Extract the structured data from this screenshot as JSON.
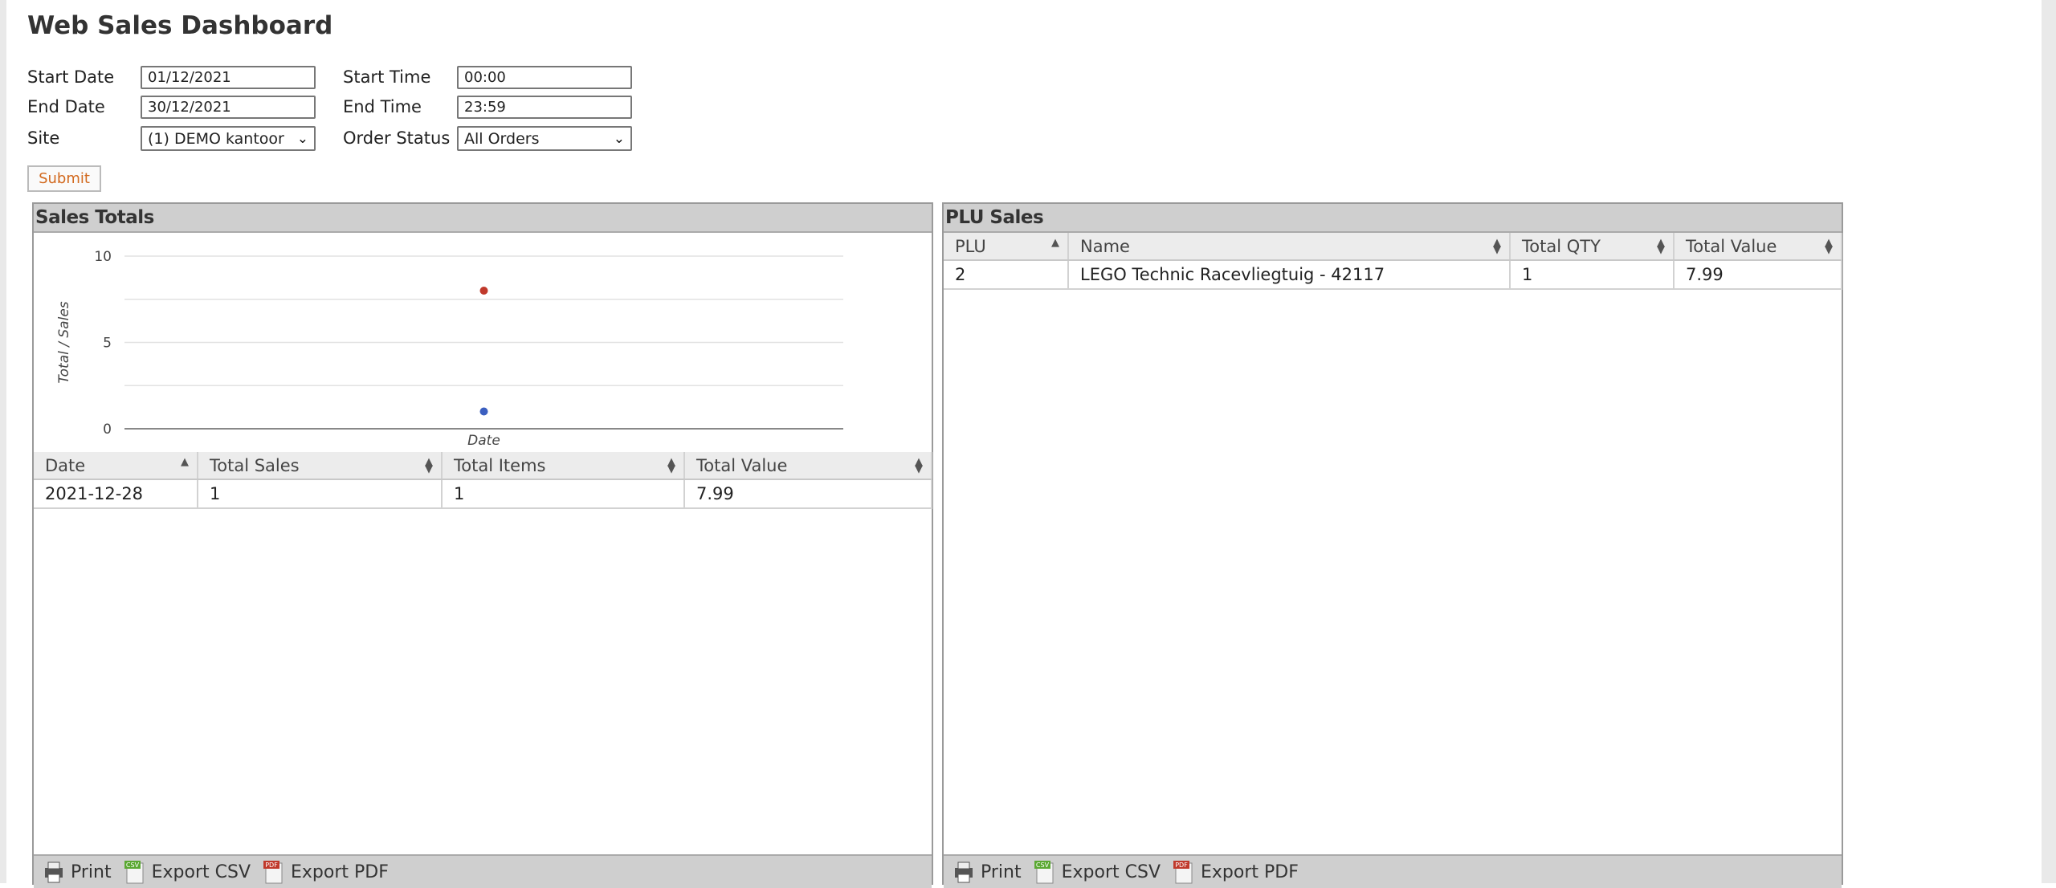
{
  "title": "Web Sales Dashboard",
  "filters": {
    "start_date_label": "Start Date",
    "start_date_value": "01/12/2021",
    "end_date_label": "End Date",
    "end_date_value": "30/12/2021",
    "site_label": "Site",
    "site_value": "(1) DEMO kantoor",
    "start_time_label": "Start Time",
    "start_time_value": "00:00",
    "end_time_label": "End Time",
    "end_time_value": "23:59",
    "order_status_label": "Order Status",
    "order_status_value": "All Orders",
    "submit_label": "Submit"
  },
  "sales_totals": {
    "header": "Sales Totals",
    "columns": [
      "Date",
      "Total Sales",
      "Total Items",
      "Total Value"
    ],
    "rows": [
      [
        "2021-12-28",
        "1",
        "1",
        "7.99"
      ]
    ],
    "footer": {
      "print": "Print",
      "csv": "Export CSV",
      "pdf": "Export PDF"
    }
  },
  "plu_sales": {
    "header": "PLU Sales",
    "columns": [
      "PLU",
      "Name",
      "Total QTY",
      "Total Value"
    ],
    "rows": [
      [
        "2",
        "LEGO Technic Racevliegtuig - 42117",
        "1",
        "7.99"
      ]
    ],
    "footer": {
      "print": "Print",
      "csv": "Export CSV",
      "pdf": "Export PDF"
    }
  },
  "chart_data": {
    "type": "scatter",
    "title": "",
    "xlabel": "Date",
    "ylabel": "Total / Sales",
    "ylim": [
      0,
      10
    ],
    "yticks": [
      0,
      5,
      10
    ],
    "grid": true,
    "x": [
      "2021-12-28"
    ],
    "series": [
      {
        "values": [
          8
        ],
        "color": "#c0392b"
      },
      {
        "values": [
          1
        ],
        "color": "#3b5fc0"
      }
    ]
  },
  "icon_labels": {
    "csv_badge": "CSV",
    "pdf_badge": "PDF"
  }
}
